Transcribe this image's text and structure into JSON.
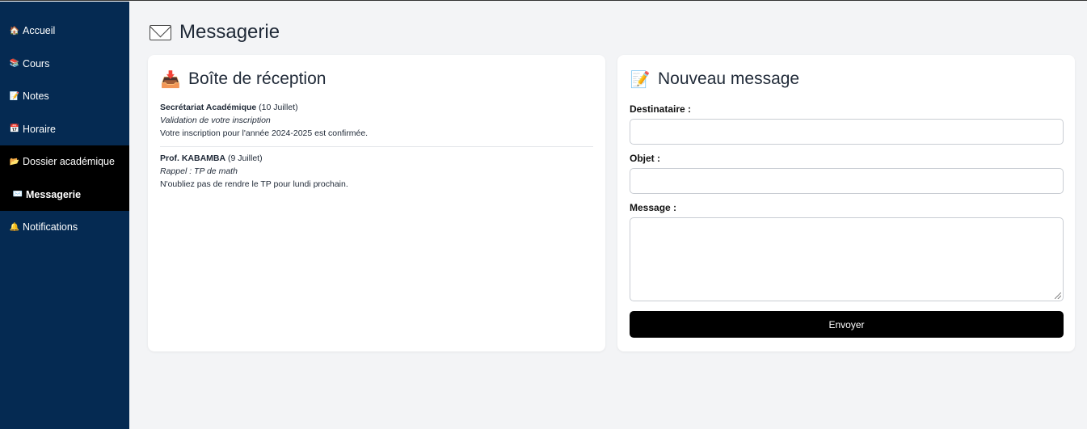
{
  "sidebar": {
    "items": [
      {
        "icon": "🏠",
        "icon_name": "home-icon",
        "label": "Accueil"
      },
      {
        "icon": "📚",
        "icon_name": "books-icon",
        "label": "Cours"
      },
      {
        "icon": "📝",
        "icon_name": "memo-icon",
        "label": "Notes"
      },
      {
        "icon": "📅",
        "icon_name": "calendar-icon",
        "label": "Horaire"
      },
      {
        "icon": "📂",
        "icon_name": "folder-icon",
        "label": "Dossier académique"
      },
      {
        "icon": "✉️",
        "icon_name": "envelope-icon",
        "label": "Messagerie"
      },
      {
        "icon": "🔔",
        "icon_name": "bell-icon",
        "label": "Notifications"
      }
    ]
  },
  "page": {
    "title": "Messagerie"
  },
  "inbox": {
    "title": "Boîte de réception",
    "icon": "📥",
    "messages": [
      {
        "sender": "Secrétariat Académique",
        "date": "(10 Juillet)",
        "subject": "Validation de votre inscription",
        "body": "Votre inscription pour l'année 2024-2025 est confirmée."
      },
      {
        "sender": "Prof. KABAMBA",
        "date": "(9 Juillet)",
        "subject": "Rappel : TP de math",
        "body": "N'oubliez pas de rendre le TP pour lundi prochain."
      }
    ]
  },
  "compose": {
    "title": "Nouveau message",
    "icon": "📝",
    "recipient_label": "Destinataire :",
    "recipient_value": "",
    "subject_label": "Objet :",
    "subject_value": "",
    "message_label": "Message :",
    "message_value": "",
    "send_label": "Envoyer"
  },
  "colors": {
    "sidebar_bg": "#052a52",
    "sidebar_active_bg": "#000000",
    "page_bg": "#f3f4f6",
    "button_bg": "#000000"
  }
}
